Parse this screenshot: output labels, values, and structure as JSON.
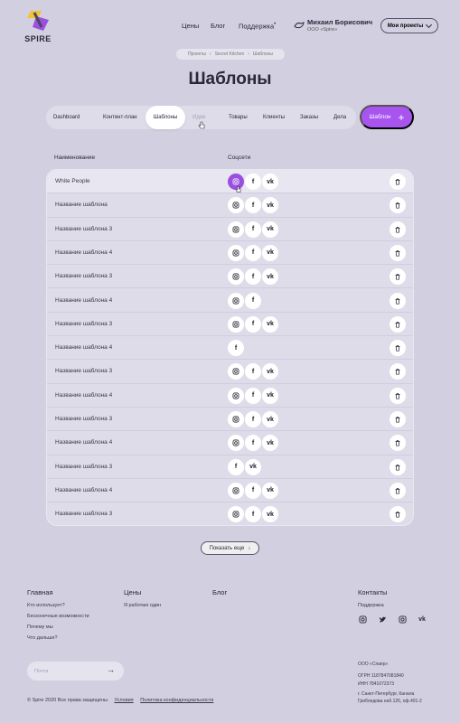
{
  "brand": {
    "name": "SPIRE"
  },
  "nav": {
    "prices": "Цены",
    "blog": "Блог",
    "support": "Поддержка",
    "support_badge": "•"
  },
  "user": {
    "name": "Михаил Борисович",
    "company": "ООО «Spire»"
  },
  "projects_button": "Мои проекты",
  "breadcrumb": [
    "Проекты",
    "Secret Kitchen",
    "Шаблоны"
  ],
  "page_title": "Шаблоны",
  "tabs": [
    {
      "label": "Dashboard"
    },
    {
      "label": "Контент-план"
    },
    {
      "label": "Шаблоны",
      "active": true
    },
    {
      "label": "Идеи",
      "muted": true
    },
    {
      "label": "Товары"
    },
    {
      "label": "Клиенты"
    },
    {
      "label": "Заказы"
    },
    {
      "label": "Дела"
    }
  ],
  "add_template_button": "Шаблон",
  "table": {
    "columns": [
      "Наименование",
      "Соцсети"
    ],
    "rows": [
      {
        "name": "White People",
        "socials": [
          "instagram",
          "facebook",
          "vk"
        ]
      },
      {
        "name": "Название шаблона",
        "socials": [
          "instagram",
          "facebook",
          "vk"
        ]
      },
      {
        "name": "Название шаблона 3",
        "socials": [
          "instagram",
          "facebook",
          "vk"
        ]
      },
      {
        "name": "Название шаблона 4",
        "socials": [
          "instagram",
          "facebook",
          "vk"
        ]
      },
      {
        "name": "Название шаблона 3",
        "socials": [
          "instagram",
          "facebook",
          "vk"
        ]
      },
      {
        "name": "Название шаблона 4",
        "socials": [
          "instagram",
          "facebook"
        ]
      },
      {
        "name": "Название шаблона 3",
        "socials": [
          "instagram",
          "facebook",
          "vk"
        ]
      },
      {
        "name": "Название шаблона 4",
        "socials": [
          "facebook"
        ]
      },
      {
        "name": "Название шаблона 3",
        "socials": [
          "instagram",
          "facebook",
          "vk"
        ]
      },
      {
        "name": "Название шаблона 4",
        "socials": [
          "instagram",
          "facebook",
          "vk"
        ]
      },
      {
        "name": "Название шаблона 3",
        "socials": [
          "instagram",
          "facebook",
          "vk"
        ]
      },
      {
        "name": "Название шаблона 4",
        "socials": [
          "instagram",
          "facebook",
          "vk"
        ]
      },
      {
        "name": "Название шаблона 3",
        "socials": [
          "facebook",
          "vk"
        ]
      },
      {
        "name": "Название шаблона 4",
        "socials": [
          "instagram",
          "facebook",
          "vk"
        ]
      },
      {
        "name": "Название шаблона 3",
        "socials": [
          "instagram",
          "facebook",
          "vk"
        ]
      }
    ]
  },
  "show_more": "Показать еще",
  "footer": {
    "col_main": {
      "title": "Главная",
      "links": [
        "Кто использует?",
        "Бесконечные возможности",
        "Почему мы",
        "Что дальше?"
      ]
    },
    "col_prices": {
      "title": "Цены",
      "links": [
        "Я работаю один"
      ]
    },
    "col_blog": {
      "title": "Блог"
    },
    "col_contacts": {
      "title": "Контакты",
      "links": [
        "Поддержка"
      ]
    },
    "email_placeholder": "Почта",
    "legal": [
      "ООО «Спаер»",
      "ОГРН 1187847081840",
      "ИНН 7841072373",
      "г. Санкт-Петербург, Канала",
      "Грибоедова наб.126, оф.401-2"
    ],
    "copyright": "© Spire 2020 Все права защищены",
    "terms": "Условия",
    "privacy": "Политика конфиденциальности"
  },
  "colors": {
    "accent": "#a855f0",
    "background": "#d2d0e0"
  }
}
